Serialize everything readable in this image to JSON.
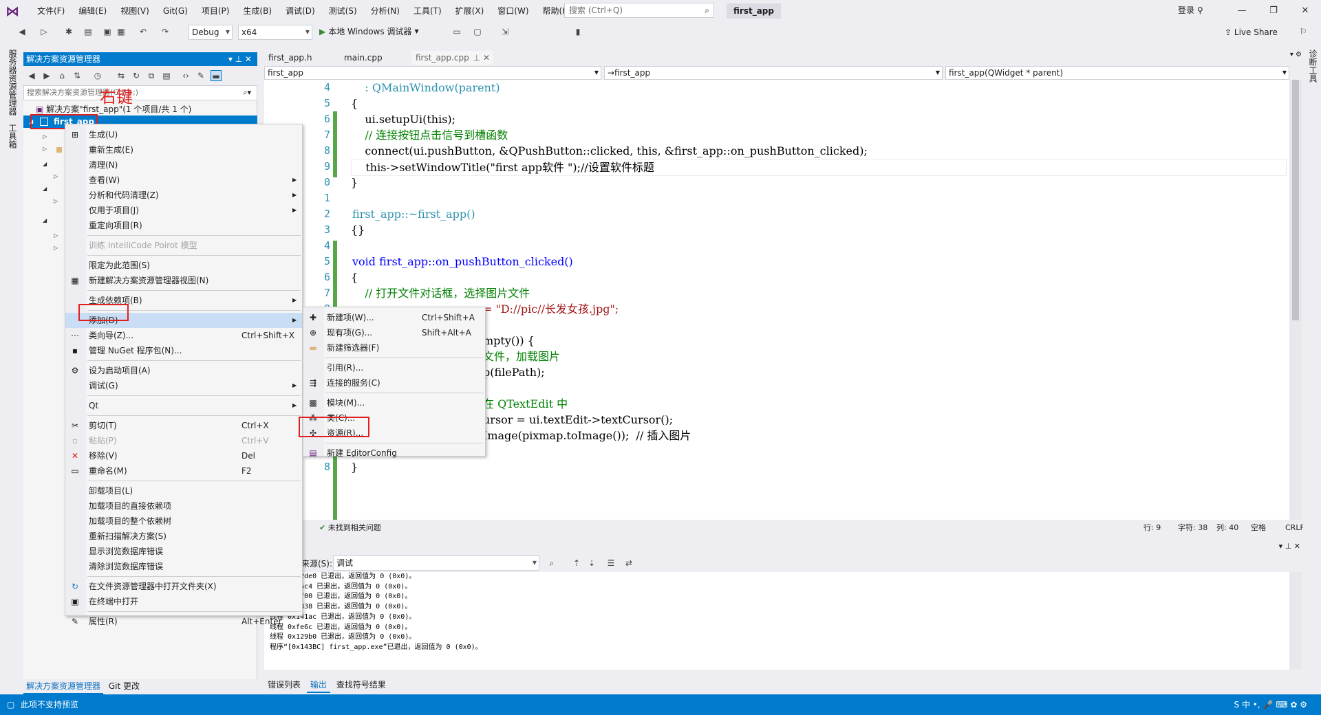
{
  "menubar": {
    "items": [
      "文件(F)",
      "编辑(E)",
      "视图(V)",
      "Git(G)",
      "项目(P)",
      "生成(B)",
      "调试(D)",
      "测试(S)",
      "分析(N)",
      "工具(T)",
      "扩展(X)",
      "窗口(W)",
      "帮助(H)"
    ],
    "search_placeholder": "搜索 (Ctrl+Q)",
    "project_name": "first_app",
    "login": "登录"
  },
  "toolbar": {
    "config": "Debug",
    "platform": "x64",
    "run_label": "本地 Windows 调试器",
    "live_share": "Live Share"
  },
  "left_rail": {
    "server_explorer": "服务器资源管理器",
    "toolbox": "工具箱"
  },
  "right_rail": {
    "label": "诊断工具"
  },
  "solution_explorer": {
    "title": "解决方案资源管理器",
    "search_placeholder": "搜索解决方案资源管理器(Ctrl+;)",
    "solution_row": "解决方案\"first_app\"(1 个项目/共 1 个)",
    "project_row": "first_app",
    "annotation": "右键",
    "bottom_tabs": [
      "解决方案资源管理器",
      "Git 更改"
    ]
  },
  "editor": {
    "tabs": [
      "first_app.h",
      "main.cpp",
      "first_app.cpp"
    ],
    "nav": [
      "first_app",
      "→first_app",
      "first_app(QWidget * parent)"
    ],
    "status": {
      "issues": "未找到相关问题",
      "line": "行: 9",
      "char": "字符: 38",
      "col": "列: 40",
      "space": "空格",
      "eol": "CRLF"
    }
  },
  "code_lines": [
    {
      "n": "4",
      "text": "    : QMainWindow(parent)"
    },
    {
      "n": "5",
      "text": "{"
    },
    {
      "n": "6",
      "text": "    ui.setupUi(this);"
    },
    {
      "n": "7",
      "text": "    // 连接按钮点击信号到槽函数"
    },
    {
      "n": "8",
      "text": "    connect(ui.pushButton, &QPushButton::clicked, this, &first_app::on_pushButton_clicked);"
    },
    {
      "n": "9",
      "text": "    this->setWindowTitle(\"first app软件 \");//设置软件标题"
    },
    {
      "n": "0",
      "text": "}"
    },
    {
      "n": "1",
      "text": ""
    },
    {
      "n": "2",
      "text": "first_app::~first_app()"
    },
    {
      "n": "3",
      "text": "{}"
    },
    {
      "n": "4",
      "text": ""
    },
    {
      "n": "5",
      "text": "void first_app::on_pushButton_clicked()"
    },
    {
      "n": "6",
      "text": "{"
    },
    {
      "n": "7",
      "text": "    // 打开文件对话框，选择图片文件"
    },
    {
      "n": "8",
      "text": "= \"D://pic//长发女孩.jpg\";"
    },
    {
      "n": "9",
      "text": ""
    },
    {
      "n": "0",
      "text": "mpty()) {"
    },
    {
      "n": "1",
      "text": "文件，加载图片"
    },
    {
      "n": "2",
      "text": "p(filePath);"
    },
    {
      "n": "3",
      "text": ""
    },
    {
      "n": "4",
      "text": "在 QTextEdit 中"
    },
    {
      "n": "5",
      "text": "ursor = ui.textEdit->textCursor();"
    },
    {
      "n": "6",
      "text": "Image(pixmap.toImage());  // 插入图片"
    },
    {
      "n": "7",
      "text": "}"
    },
    {
      "n": "8",
      "text": "}"
    }
  ],
  "output": {
    "source_label": "显示输出来源(S):",
    "source_value": "调试",
    "lines": [
      "线程 0x12de0 已退出，返回值为 0 (0x0)。",
      "线程 0x15c4 已退出，返回值为 0 (0x0)。",
      "线程 0x1f00 已退出，返回值为 0 (0x0)。",
      "线程 0x3838 已退出，返回值为 0 (0x0)。",
      "线程 0x141ac 已退出，返回值为 0 (0x0)。",
      "线程 0xfe6c 已退出，返回值为 0 (0x0)。",
      "线程 0x129b0 已退出，返回值为 0 (0x0)。",
      "程序“[0x143BC] first_app.exe”已退出，返回值为 0 (0x0)。"
    ],
    "tabs": [
      "错误列表",
      "输出",
      "查找符号结果"
    ]
  },
  "context_menu": {
    "items": [
      {
        "label": "生成(U)",
        "shortcut": "",
        "submenu": false,
        "disabled": false,
        "icon": "build-icon"
      },
      {
        "label": "重新生成(E)",
        "shortcut": "",
        "submenu": false,
        "disabled": false,
        "icon": ""
      },
      {
        "label": "清理(N)",
        "shortcut": "",
        "submenu": false,
        "disabled": false,
        "icon": ""
      },
      {
        "label": "查看(W)",
        "shortcut": "",
        "submenu": true,
        "disabled": false,
        "icon": ""
      },
      {
        "label": "分析和代码清理(Z)",
        "shortcut": "",
        "submenu": true,
        "disabled": false,
        "icon": ""
      },
      {
        "label": "仅用于项目(J)",
        "shortcut": "",
        "submenu": true,
        "disabled": false,
        "icon": ""
      },
      {
        "label": "重定向项目(R)",
        "shortcut": "",
        "submenu": false,
        "disabled": false,
        "icon": ""
      },
      {
        "sep": true
      },
      {
        "label": "训练 IntelliCode Poirot 模型",
        "shortcut": "",
        "submenu": false,
        "disabled": true,
        "icon": ""
      },
      {
        "sep": true
      },
      {
        "label": "限定为此范围(S)",
        "shortcut": "",
        "submenu": false,
        "disabled": false,
        "icon": ""
      },
      {
        "label": "新建解决方案资源管理器视图(N)",
        "shortcut": "",
        "submenu": false,
        "disabled": false,
        "icon": "new-view-icon"
      },
      {
        "sep": true
      },
      {
        "label": "生成依赖项(B)",
        "shortcut": "",
        "submenu": true,
        "disabled": false,
        "icon": ""
      },
      {
        "sep": true
      },
      {
        "label": "添加(D)",
        "shortcut": "",
        "submenu": true,
        "disabled": false,
        "icon": "",
        "highlight": true
      },
      {
        "label": "类向导(Z)...",
        "shortcut": "Ctrl+Shift+X",
        "submenu": false,
        "disabled": false,
        "icon": "class-wizard-icon"
      },
      {
        "label": "管理 NuGet 程序包(N)...",
        "shortcut": "",
        "submenu": false,
        "disabled": false,
        "icon": "nuget-icon"
      },
      {
        "sep": true
      },
      {
        "label": "设为启动项目(A)",
        "shortcut": "",
        "submenu": false,
        "disabled": false,
        "icon": "gear-icon"
      },
      {
        "label": "调试(G)",
        "shortcut": "",
        "submenu": true,
        "disabled": false,
        "icon": ""
      },
      {
        "sep": true
      },
      {
        "label": "Qt",
        "shortcut": "",
        "submenu": true,
        "disabled": false,
        "icon": ""
      },
      {
        "sep": true
      },
      {
        "label": "剪切(T)",
        "shortcut": "Ctrl+X",
        "submenu": false,
        "disabled": false,
        "icon": "cut-icon"
      },
      {
        "label": "粘贴(P)",
        "shortcut": "Ctrl+V",
        "submenu": false,
        "disabled": true,
        "icon": "paste-icon"
      },
      {
        "label": "移除(V)",
        "shortcut": "Del",
        "submenu": false,
        "disabled": false,
        "icon": "remove-icon"
      },
      {
        "label": "重命名(M)",
        "shortcut": "F2",
        "submenu": false,
        "disabled": false,
        "icon": "rename-icon"
      },
      {
        "sep": true
      },
      {
        "label": "卸载项目(L)",
        "shortcut": "",
        "submenu": false,
        "disabled": false,
        "icon": ""
      },
      {
        "label": "加载项目的直接依赖项",
        "shortcut": "",
        "submenu": false,
        "disabled": false,
        "icon": ""
      },
      {
        "label": "加载项目的整个依赖树",
        "shortcut": "",
        "submenu": false,
        "disabled": false,
        "icon": ""
      },
      {
        "label": "重新扫描解决方案(S)",
        "shortcut": "",
        "submenu": false,
        "disabled": false,
        "icon": ""
      },
      {
        "label": "显示浏览数据库错误",
        "shortcut": "",
        "submenu": false,
        "disabled": false,
        "icon": ""
      },
      {
        "label": "清除浏览数据库错误",
        "shortcut": "",
        "submenu": false,
        "disabled": false,
        "icon": ""
      },
      {
        "sep": true
      },
      {
        "label": "在文件资源管理器中打开文件夹(X)",
        "shortcut": "",
        "submenu": false,
        "disabled": false,
        "icon": "refresh-icon"
      },
      {
        "label": "在终端中打开",
        "shortcut": "",
        "submenu": false,
        "disabled": false,
        "icon": "terminal-icon"
      },
      {
        "sep": true
      },
      {
        "label": "属性(R)",
        "shortcut": "Alt+Enter",
        "submenu": false,
        "disabled": false,
        "icon": "wrench-icon"
      }
    ]
  },
  "add_submenu": {
    "items": [
      {
        "label": "新建项(W)...",
        "shortcut": "Ctrl+Shift+A",
        "icon": "new-item-icon"
      },
      {
        "label": "现有项(G)...",
        "shortcut": "Shift+Alt+A",
        "icon": "existing-item-icon"
      },
      {
        "label": "新建筛选器(F)",
        "shortcut": "",
        "icon": "folder-icon"
      },
      {
        "sep": true
      },
      {
        "label": "引用(R)...",
        "shortcut": "",
        "icon": ""
      },
      {
        "label": "连接的服务(C)",
        "shortcut": "",
        "icon": "connected-service-icon"
      },
      {
        "sep": true
      },
      {
        "label": "模块(M)...",
        "shortcut": "",
        "icon": "module-icon"
      },
      {
        "label": "类(C)...",
        "shortcut": "",
        "icon": "class-icon"
      },
      {
        "label": "资源(R)...",
        "shortcut": "",
        "icon": "resource-icon"
      },
      {
        "sep": true
      },
      {
        "label": "新建 EditorConfig",
        "shortcut": "",
        "icon": "editorconfig-icon"
      }
    ]
  },
  "status_bar": {
    "text": "此项不支持预览"
  },
  "colors": {
    "accent": "#007acc",
    "annotation_red": "#e0201f",
    "menu_highlight": "#c9def5"
  }
}
